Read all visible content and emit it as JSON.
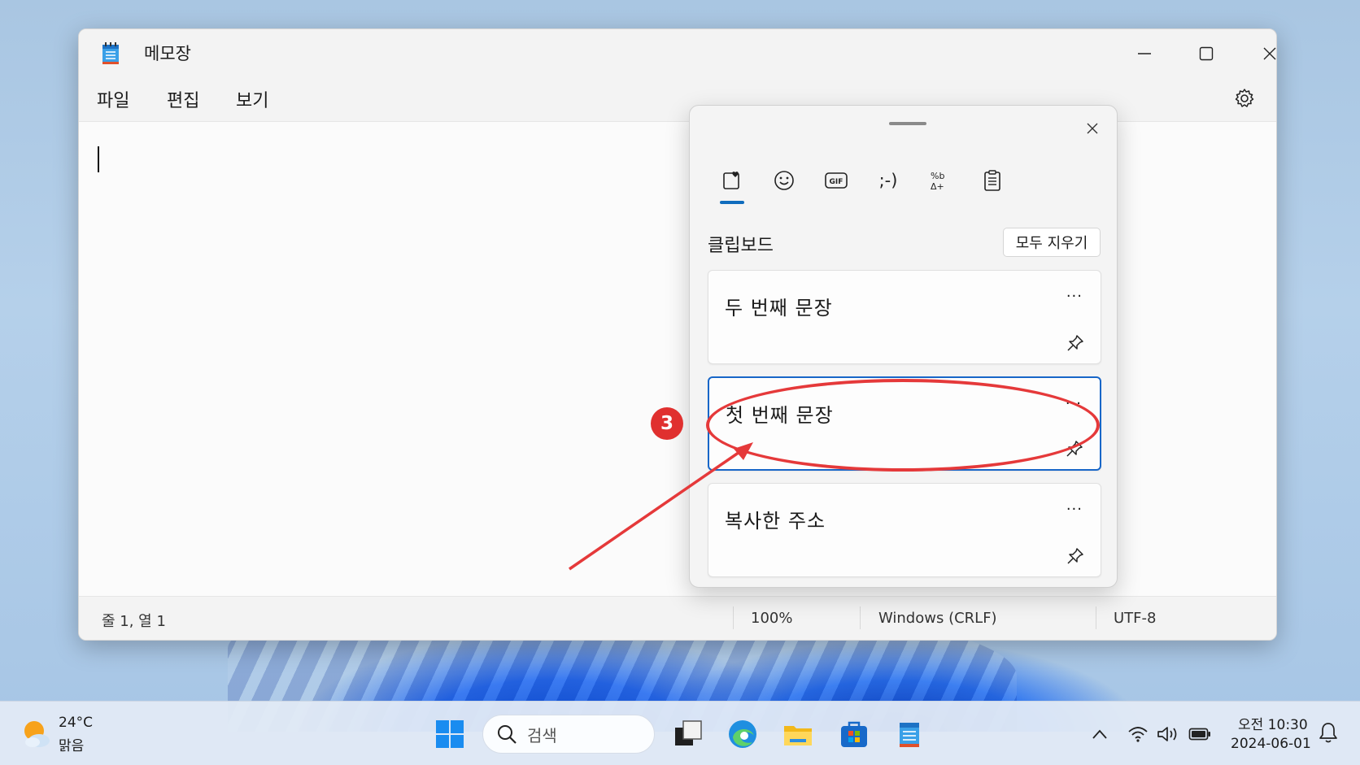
{
  "window": {
    "title": "메모장",
    "menu": [
      "파일",
      "편집",
      "보기"
    ],
    "status": {
      "position": "줄 1, 열 1",
      "zoom": "100%",
      "line_ending": "Windows (CRLF)",
      "encoding": "UTF-8"
    }
  },
  "clipboard_panel": {
    "section_title": "클립보드",
    "clear_all_label": "모두 지우기",
    "categories": [
      "favorites-icon",
      "emoji-icon",
      "gif-icon",
      "kaomoji-icon",
      "symbols-icon",
      "clipboard-icon"
    ],
    "category_labels": {
      "gif": "GIF",
      "kaomoji": ";-)",
      "symbols": "%b\nΔ+"
    },
    "items": [
      {
        "text": "두 번째 문장",
        "more": "...",
        "selected": false
      },
      {
        "text": "첫 번째 문장",
        "more": "...",
        "selected": true
      },
      {
        "text": "복사한 주소",
        "more": "...",
        "selected": false
      }
    ]
  },
  "annotation": {
    "step": "3",
    "color": "#e5393a"
  },
  "taskbar": {
    "weather": {
      "temp": "24°C",
      "condition": "맑음"
    },
    "search_label": "검색",
    "clock": {
      "time": "오전 10:30",
      "date": "2024-06-01"
    }
  },
  "colors": {
    "accent": "#0f6cbd",
    "selection_border": "#1766c8"
  }
}
